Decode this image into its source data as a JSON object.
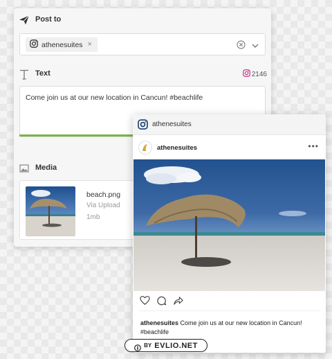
{
  "compose": {
    "post_to_label": "Post to",
    "account_chip": "athenesuites",
    "chip_remove": "×",
    "text_label": "Text",
    "follower_count": "2146",
    "post_text": "Come join us at our new location in Cancun! #beachlife",
    "media_label": "Media",
    "media": {
      "file_name": "beach.png",
      "source": "Via Upload",
      "size": "1mb"
    }
  },
  "preview": {
    "account_name": "athenesuites",
    "username": "athenesuites",
    "more": "•••",
    "caption_user": "athenesuites",
    "caption_text": " Come join us at our new location in Cancun! #beachlife"
  },
  "watermark": {
    "by": "BY",
    "site": "EVLIO.NET"
  },
  "colors": {
    "progress": "#7ab648",
    "instagram_pink": "#c13584",
    "sky": "#2d5f9e",
    "sand": "#d9d6d0"
  },
  "icons": [
    "paper-plane-icon",
    "instagram-icon",
    "clear-circle-icon",
    "chevron-down-icon",
    "text-t-icon",
    "image-icon",
    "heart-icon",
    "comment-icon",
    "share-icon",
    "more-icon",
    "avatar"
  ]
}
